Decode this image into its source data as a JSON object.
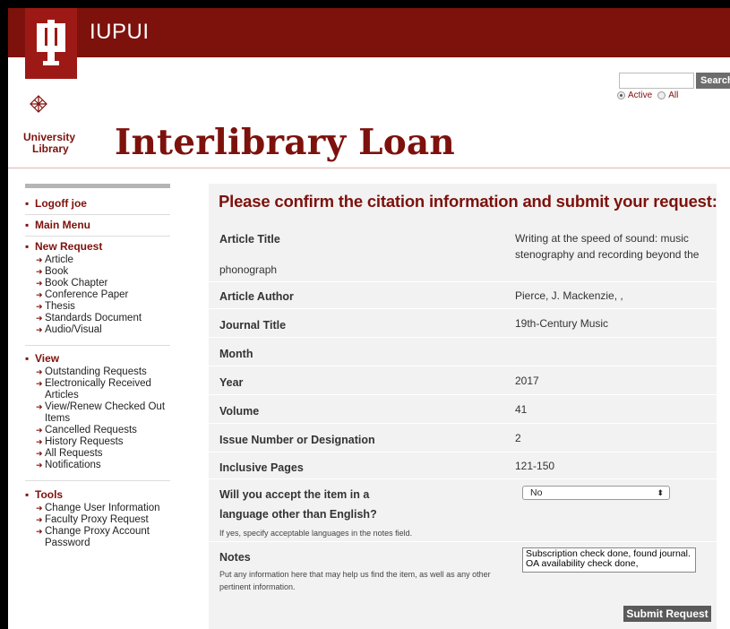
{
  "header": {
    "brand": "IUPUI",
    "search_button": "Search",
    "radio_active": "Active",
    "radio_all": "All",
    "library_line1": "University",
    "library_line2": "Library",
    "page_title": "Interlibrary Loan",
    "brand_color": "#7d110c"
  },
  "sidebar": {
    "logoff": "Logoff joe",
    "main_menu": "Main Menu",
    "new_request": {
      "heading": "New Request",
      "items": [
        "Article",
        "Book",
        "Book Chapter",
        "Conference Paper",
        "Thesis",
        "Standards Document",
        "Audio/Visual"
      ]
    },
    "view": {
      "heading": "View",
      "items": [
        "Outstanding Requests",
        "Electronically Received Articles",
        "View/Renew Checked Out Items",
        "Cancelled Requests",
        "History Requests",
        "All Requests",
        "Notifications"
      ]
    },
    "tools": {
      "heading": "Tools",
      "items": [
        "Change User Information",
        "Faculty Proxy Request",
        "Change Proxy Account Password"
      ]
    }
  },
  "main": {
    "confirm_title": "Please confirm the citation information and submit your request:",
    "fields": {
      "article_title_label": "Article Title",
      "article_title_value": "Writing at the speed of sound: music stenography and recording beyond the",
      "article_title_overflow": "phonograph",
      "article_author_label": "Article Author",
      "article_author_value": "Pierce, J. Mackenzie, ,",
      "journal_title_label": "Journal Title",
      "journal_title_value": "19th-Century Music",
      "month_label": "Month",
      "year_label": "Year",
      "year_value": "2017",
      "volume_label": "Volume",
      "volume_value": "41",
      "issue_label": "Issue Number or Designation",
      "issue_value": "2",
      "pages_label": "Inclusive Pages",
      "pages_value": "121-150",
      "language_label_1": "Will you accept the item in a",
      "language_label_2": "language other than English?",
      "language_hint": "If yes, specify acceptable languages in the notes field.",
      "language_selected": "No",
      "notes_label": "Notes",
      "notes_hint": "Put any information here that may help us find the item, as well as any other pertinent information.",
      "notes_value": "Subscription check done, found journal. OA availability check done,"
    },
    "submit_label": "Submit Request"
  }
}
